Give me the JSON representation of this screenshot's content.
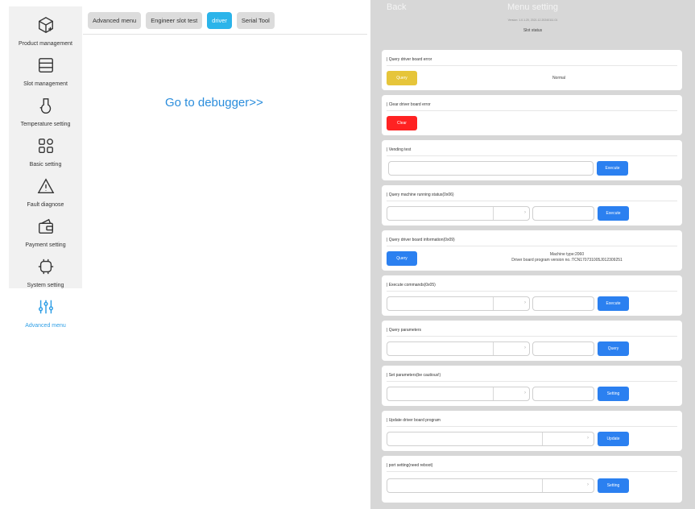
{
  "sidebar": {
    "items": [
      {
        "label": "Product management",
        "icon": "box-plus-icon"
      },
      {
        "label": "Slot management",
        "icon": "slot-icon"
      },
      {
        "label": "Temperature setting",
        "icon": "temperature-icon"
      },
      {
        "label": "Basic setting",
        "icon": "grid-icon"
      },
      {
        "label": "Fault diagnose",
        "icon": "warning-icon"
      },
      {
        "label": "Payment setting",
        "icon": "wallet-icon"
      },
      {
        "label": "System setting",
        "icon": "system-icon"
      },
      {
        "label": "Advanced menu",
        "icon": "sliders-icon"
      }
    ],
    "active_index": 7,
    "active_color": "#2f9fe6"
  },
  "tabs": [
    {
      "label": "Advanced menu"
    },
    {
      "label": "Engineer slot test"
    },
    {
      "label": "driver"
    },
    {
      "label": "Serial Tool"
    }
  ],
  "active_tab": "driver",
  "main": {
    "debugger_link": "Go to debugger>>"
  },
  "overlay": {
    "back": "Back",
    "title": "Menu setting",
    "version": "Version: 1.0.1.20, 2021.12.20240111.01",
    "slot_status": "Slot status",
    "cards": [
      {
        "title": "| Query driver board error",
        "button": "Query",
        "result": "Normal"
      },
      {
        "title": "| Clear driver board error",
        "button": "Clear"
      },
      {
        "title": "| Vending test",
        "button": "Execute",
        "input_value": ""
      },
      {
        "title": "| Query machine running status(0x06)",
        "button": "Execute"
      },
      {
        "title": "| Query driver board information(0x09)",
        "button": "Query",
        "info_line1": "Machine type:2060",
        "info_line2": "Driver board program version no.:TCN170731005J012309251"
      },
      {
        "title": "| Execute commands(0x05)",
        "button": "Execute"
      },
      {
        "title": "| Query parameters",
        "button": "Query"
      },
      {
        "title": "| Set parameters(be cautious!)",
        "button": "Setting"
      },
      {
        "title": "| Update driver board program",
        "button": "Update"
      },
      {
        "title": "| port setting(need reboot)",
        "button": "Setting"
      }
    ]
  },
  "colors": {
    "accent": "#2b80f0",
    "query_yellow": "#e6c53a",
    "clear_red": "#ff2222",
    "tab_active": "#2bb4ea"
  }
}
